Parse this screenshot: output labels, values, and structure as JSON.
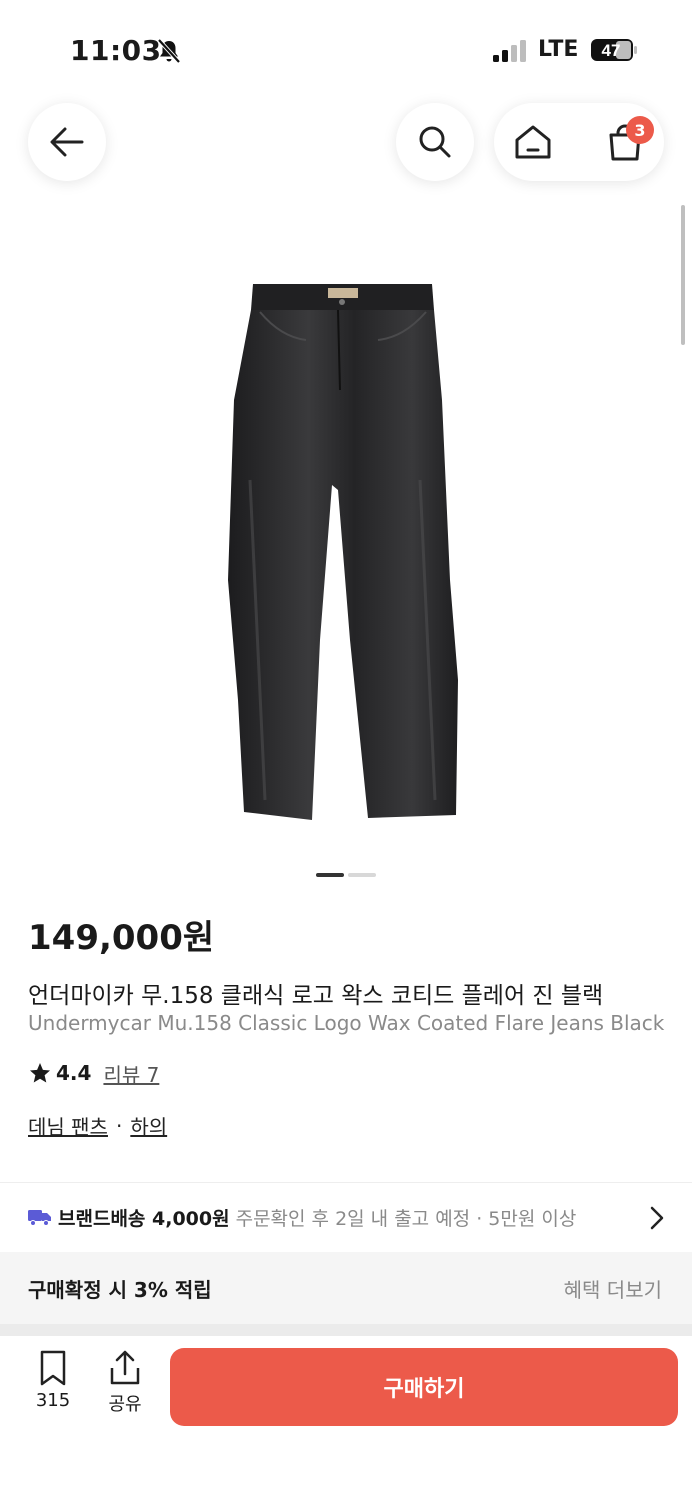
{
  "status_bar": {
    "time": "11:03",
    "network": "LTE",
    "battery": "47"
  },
  "header": {
    "cart_count": "3"
  },
  "product": {
    "image_dots_total": 2,
    "image_dots_active": 1,
    "price": "149,000원",
    "title_ko": "언더마이카 무.158 클래식 로고 왁스 코티드 플레어 진 블랙",
    "title_en": "Undermycar Mu.158 Classic Logo Wax Coated Flare Jeans Black",
    "rating": "4.4",
    "review_label": "리뷰 7",
    "categories": [
      "데님 팬츠",
      "하의"
    ]
  },
  "shipping": {
    "label": "브랜드배송 4,000원",
    "detail": "주문확인 후 2일 내 출고 예정 · 5만원 이상"
  },
  "benefit": {
    "text": "구매확정 시 3% 적립",
    "more": "혜택 더보기"
  },
  "bottom_bar": {
    "bookmark_count": "315",
    "share_label": "공유",
    "buy_label": "구매하기"
  },
  "colors": {
    "accent": "#ec5a4a"
  }
}
